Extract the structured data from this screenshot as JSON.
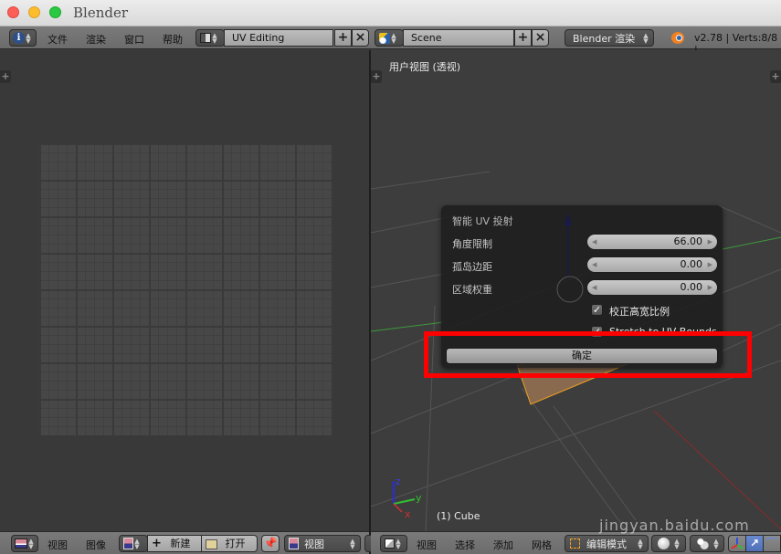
{
  "window": {
    "title": "Blender"
  },
  "top_header": {
    "menus": [
      "文件",
      "渲染",
      "窗口",
      "帮助"
    ],
    "screen_layout": "UV Editing",
    "scene": "Scene",
    "render_engine": "Blender 渲染",
    "status": "v2.78 | Verts:8/8 |"
  },
  "uv_editor": {
    "footer_menus": [
      "视图",
      "图像"
    ],
    "new_button": "新建",
    "open_button": "打开",
    "view_select": "视图"
  },
  "viewport": {
    "view_label": "用户视图 (透视)",
    "object_label": "(1) Cube",
    "axes": {
      "x": "x",
      "y": "y",
      "z": "z"
    },
    "footer_menus": [
      "视图",
      "选择",
      "添加",
      "网格"
    ],
    "mode_select": "编辑模式"
  },
  "operator_panel": {
    "title": "智能 UV 投射",
    "fields": [
      {
        "label": "角度限制",
        "value": "66.00"
      },
      {
        "label": "孤岛边距",
        "value": "0.00"
      },
      {
        "label": "区域权重",
        "value": "0.00"
      }
    ],
    "checkboxes": [
      {
        "label": "校正高宽比例",
        "checked": true
      },
      {
        "label": "Stretch to UV Bounds",
        "checked": true
      }
    ],
    "confirm_button": "确定"
  },
  "annotation": {
    "color": "#ff0000"
  },
  "watermark": "jingyan.baidu.com"
}
